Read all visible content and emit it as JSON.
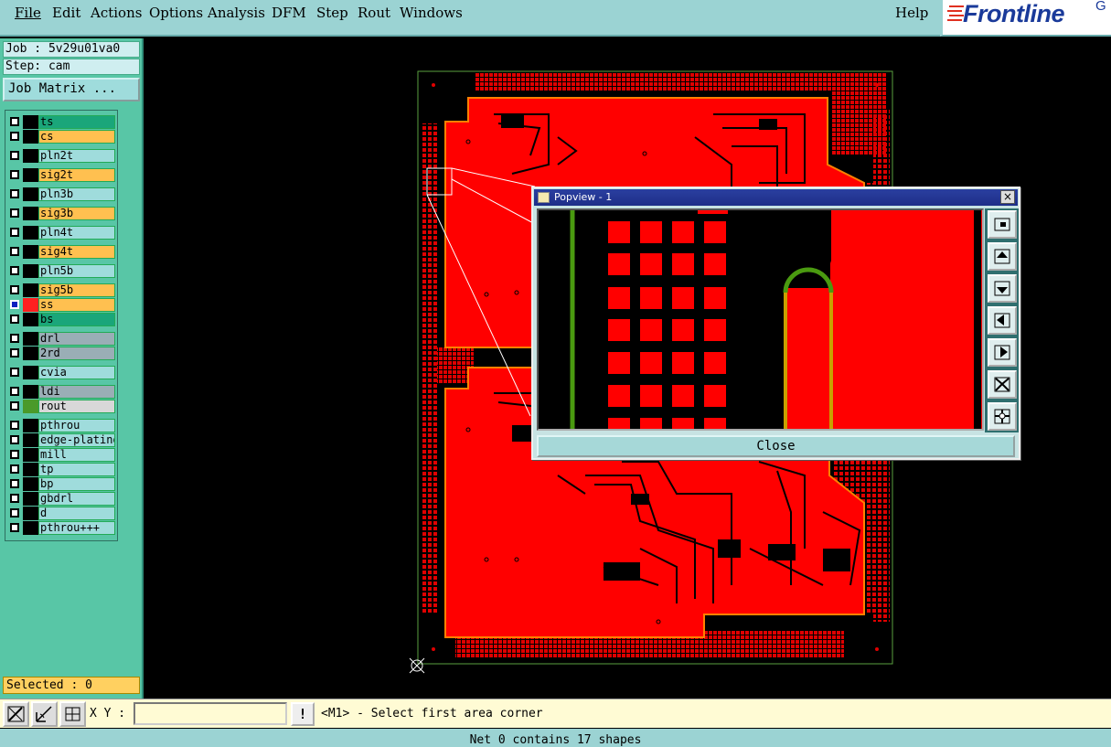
{
  "menubar": {
    "items": [
      "File",
      "Edit",
      "Actions",
      "Options",
      "Analysis",
      "DFM",
      "Step",
      "Rout",
      "Windows"
    ],
    "help": "Help"
  },
  "logo": {
    "text": "Frontline",
    "suffix": "G"
  },
  "job": {
    "label": "Job : 5v29u01va0",
    "step": "Step: cam",
    "matrix_button": "Job Matrix ..."
  },
  "layers": [
    {
      "name": "ts",
      "color": "#1aa67a",
      "marker": ""
    },
    {
      "name": "cs",
      "color": "#ffc050",
      "marker": ""
    },
    {
      "name": "pln2t",
      "color": "#9fdcdc",
      "marker": ""
    },
    {
      "name": "sig2t",
      "color": "#ffc050",
      "marker": ""
    },
    {
      "name": "pln3b",
      "color": "#9fdcdc",
      "marker": ""
    },
    {
      "name": "sig3b",
      "color": "#ffc050",
      "marker": ""
    },
    {
      "name": "pln4t",
      "color": "#9fdcdc",
      "marker": ""
    },
    {
      "name": "sig4t",
      "color": "#ffc050",
      "marker": ""
    },
    {
      "name": "pln5b",
      "color": "#9fdcdc",
      "marker": ""
    },
    {
      "name": "sig5b",
      "color": "#ffc050",
      "marker": ""
    },
    {
      "name": "ss",
      "color": "#ffc050",
      "marker": "#ff2020"
    },
    {
      "name": "bs",
      "color": "#1aa67a",
      "marker": ""
    },
    {
      "name": "drl",
      "color": "#9aaeb6",
      "marker": ""
    },
    {
      "name": "2rd",
      "color": "#9aaeb6",
      "marker": ""
    },
    {
      "name": "cvia",
      "color": "#9fdcdc",
      "marker": ""
    },
    {
      "name": "ldi",
      "color": "#9aaeb6",
      "marker": ""
    },
    {
      "name": "rout",
      "color": "#d8d8d8",
      "marker": "#4a9a2a"
    },
    {
      "name": "pthrou",
      "color": "#9fdcdc",
      "marker": ""
    },
    {
      "name": "edge-plating",
      "color": "#9fdcdc",
      "marker": ""
    },
    {
      "name": "mill",
      "color": "#9fdcdc",
      "marker": ""
    },
    {
      "name": "tp",
      "color": "#9fdcdc",
      "marker": ""
    },
    {
      "name": "bp",
      "color": "#9fdcdc",
      "marker": ""
    },
    {
      "name": "gbdrl",
      "color": "#9fdcdc",
      "marker": ""
    },
    {
      "name": "d",
      "color": "#9fdcdc",
      "marker": ""
    },
    {
      "name": "pthrou+++",
      "color": "#9fdcdc",
      "marker": ""
    }
  ],
  "selected": "Selected : 0",
  "toolbar": {
    "xy_label": "X Y :",
    "xy_value": "",
    "alert": "!",
    "prompt": "<M1> - Select first area corner"
  },
  "status": "Net 0 contains 17 shapes",
  "popview": {
    "title": "Popview - 1",
    "close_label": "Close",
    "close_x": "×"
  }
}
